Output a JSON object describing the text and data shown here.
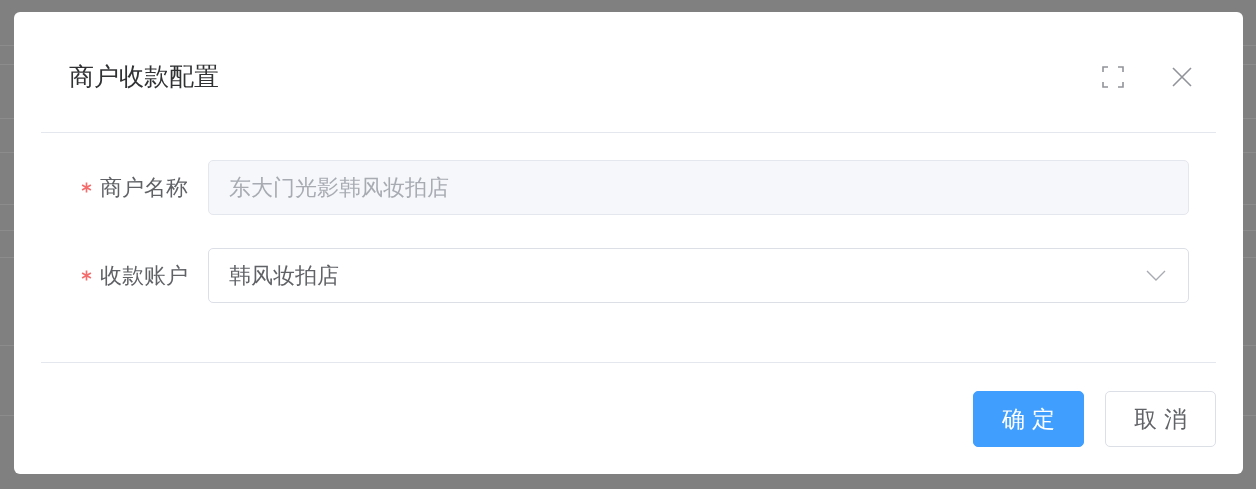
{
  "dialog": {
    "title": "商户收款配置",
    "fields": [
      {
        "label": "商户名称",
        "required": true,
        "kind": "input",
        "value": "东大门光影韩风妆拍店",
        "disabled": true
      },
      {
        "label": "收款账户",
        "required": true,
        "kind": "select",
        "value": "韩风妆拍店",
        "disabled": false
      }
    ],
    "buttons": [
      {
        "label": "确 定",
        "kind": "primary"
      },
      {
        "label": "取 消",
        "kind": "default"
      }
    ]
  }
}
